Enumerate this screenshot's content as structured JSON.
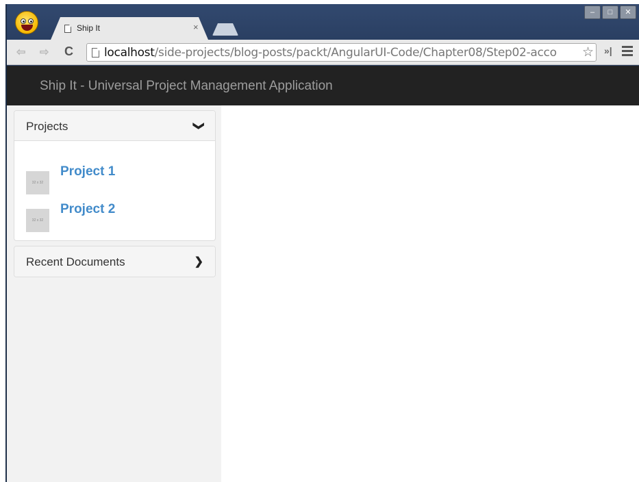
{
  "browser": {
    "tab_title": "Ship It",
    "tab_close": "×",
    "url_host": "localhost",
    "url_path": "/side-projects/blog-posts/packt/AngularUI-Code/Chapter08/Step02-acco",
    "window_buttons": [
      "–",
      "□",
      "✕"
    ],
    "back_icon": "⇦",
    "forward_icon": "⇨",
    "reload_icon": "C",
    "bookmark_icon": "☆",
    "extensions_icon": "»|"
  },
  "navbar": {
    "brand": "Ship It - Universal Project Management Application"
  },
  "sidebar": {
    "panels": [
      {
        "title": "Projects",
        "state": "expanded",
        "chevron": "❯",
        "items": [
          {
            "label": "Project 1",
            "thumb": "32 x 32"
          },
          {
            "label": "Project 2",
            "thumb": "32 x 32"
          }
        ]
      },
      {
        "title": "Recent Documents",
        "state": "collapsed",
        "chevron": "❯"
      }
    ]
  },
  "colors": {
    "navbar_bg": "#222222",
    "brand_text": "#9d9d9d",
    "link": "#428bca",
    "sidebar_bg": "#f2f2f2"
  }
}
